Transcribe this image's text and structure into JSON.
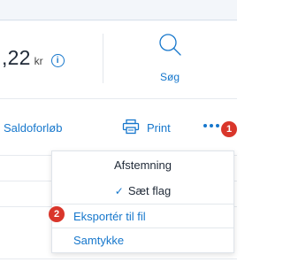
{
  "balance": {
    "amount": ",22",
    "unit": "kr",
    "info_icon": "info-icon"
  },
  "search": {
    "label": "Søg",
    "icon": "search-icon"
  },
  "toolbar": {
    "history_label": "Saldoforløb",
    "print_label": "Print",
    "more_icon": "more-dots-icon"
  },
  "badges": {
    "first": "1",
    "second": "2"
  },
  "menu": {
    "items": [
      {
        "label": "Afstemning"
      },
      {
        "label": "Sæt flag",
        "checked": true
      },
      {
        "label": "Eksportér til fil"
      },
      {
        "label": "Samtykke"
      }
    ],
    "check_glyph": "✓"
  },
  "colors": {
    "accent": "#1677cc",
    "badge": "#d9362b",
    "text": "#1f2937"
  }
}
